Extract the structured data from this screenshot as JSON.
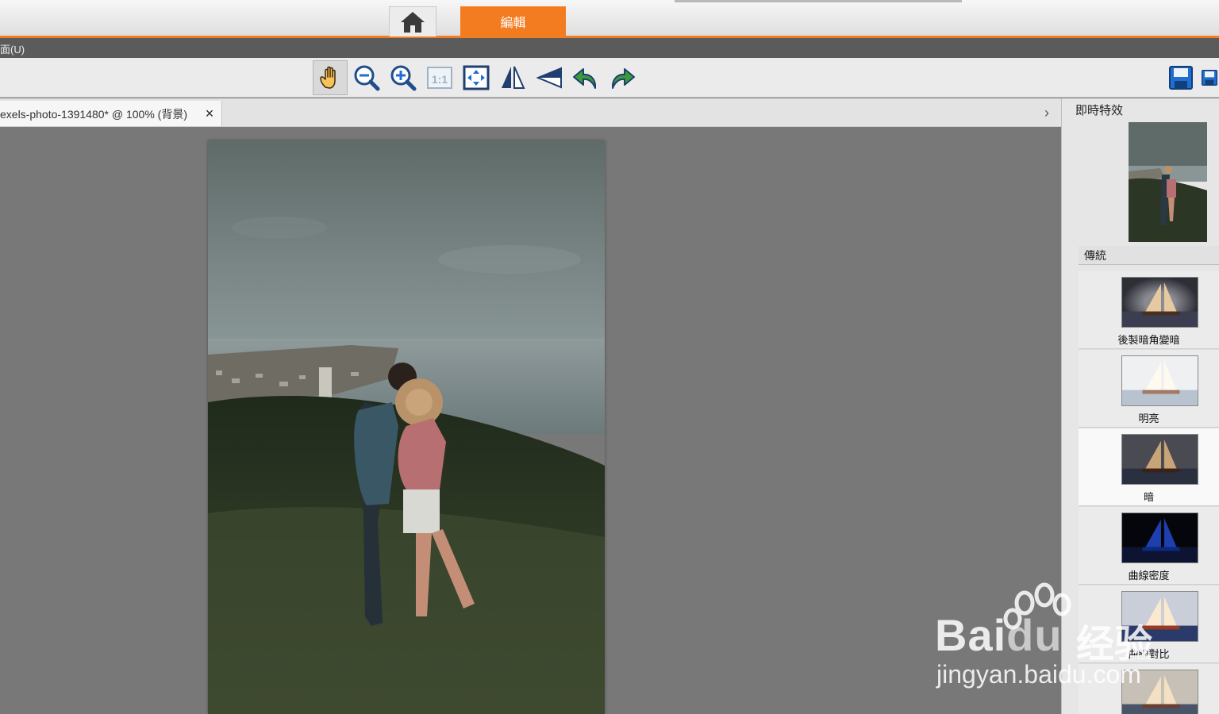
{
  "tabs": {
    "home_icon": "home-icon",
    "edit_label": "編輯"
  },
  "menu": {
    "item_label": "面(U)"
  },
  "toolbar": {
    "tools": [
      "hand-icon",
      "zoom-out-icon",
      "zoom-in-icon",
      "actual-size-icon",
      "fit-to-window-icon",
      "flip-horizontal-icon",
      "flip-vertical-icon",
      "undo-icon",
      "redo-icon",
      "save-icon",
      "save-as-icon"
    ]
  },
  "document": {
    "tab_title": "exels-photo-1391480* @ 100% (背景)",
    "close_symbol": "×",
    "expand_symbol": "›"
  },
  "panel": {
    "title": "即時特效",
    "category": "傳統",
    "effects": [
      {
        "label": "後製暗角變暗"
      },
      {
        "label": "明亮"
      },
      {
        "label": "暗"
      },
      {
        "label": "曲線密度"
      },
      {
        "label": "曲線對比"
      }
    ]
  },
  "watermark": {
    "brand": "Bai",
    "brand_suffix": "du",
    "chinese": "经验",
    "url": "jingyan.baidu.com"
  },
  "colors": {
    "accent": "#f47c20",
    "menu_bg": "#5b5b5b",
    "canvas_bg": "#787878"
  }
}
